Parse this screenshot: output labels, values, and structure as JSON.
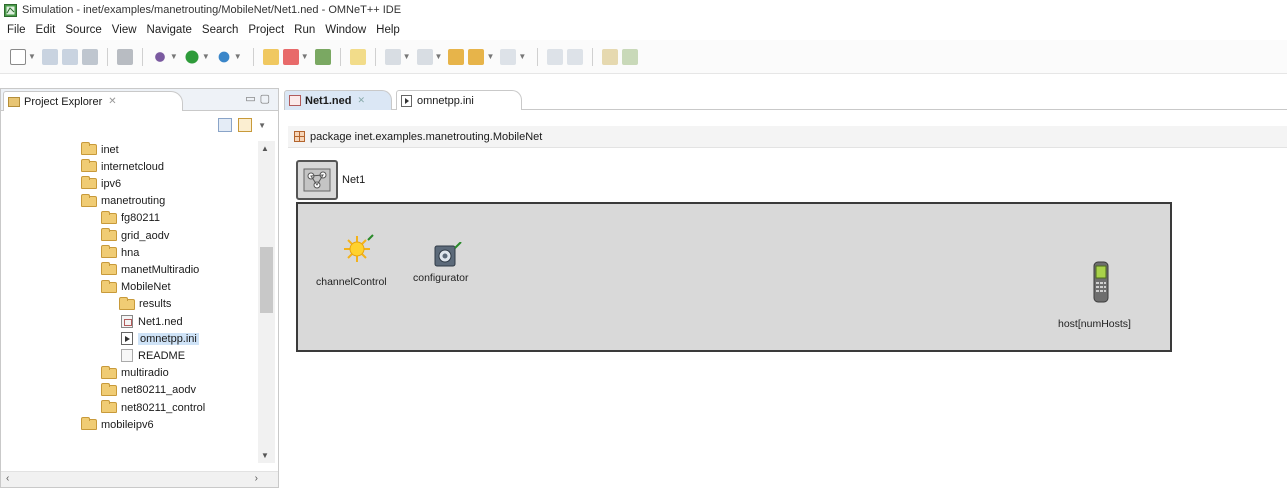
{
  "window": {
    "title": "Simulation - inet/examples/manetrouting/MobileNet/Net1.ned - OMNeT++ IDE",
    "icon": "omnetpp-ide-icon"
  },
  "menu": [
    "File",
    "Edit",
    "Source",
    "View",
    "Navigate",
    "Search",
    "Project",
    "Run",
    "Window",
    "Help"
  ],
  "explorer": {
    "tab_label": "Project Explorer",
    "tab_close": "✕",
    "tree": [
      {
        "label": "inet",
        "type": "folder",
        "depth": 1
      },
      {
        "label": "internetcloud",
        "type": "folder",
        "depth": 1
      },
      {
        "label": "ipv6",
        "type": "folder",
        "depth": 1
      },
      {
        "label": "manetrouting",
        "type": "folder",
        "depth": 1
      },
      {
        "label": "fg80211",
        "type": "folder",
        "depth": 2
      },
      {
        "label": "grid_aodv",
        "type": "folder",
        "depth": 2
      },
      {
        "label": "hna",
        "type": "folder",
        "depth": 2
      },
      {
        "label": "manetMultiradio",
        "type": "folder",
        "depth": 2
      },
      {
        "label": "MobileNet",
        "type": "folder",
        "depth": 2
      },
      {
        "label": "results",
        "type": "folder",
        "depth": 3
      },
      {
        "label": "Net1.ned",
        "type": "ned",
        "depth": 3
      },
      {
        "label": "omnetpp.ini",
        "type": "ini",
        "depth": 3,
        "selected": true
      },
      {
        "label": "README",
        "type": "txt",
        "depth": 3
      },
      {
        "label": "multiradio",
        "type": "folder",
        "depth": 2
      },
      {
        "label": "net80211_aodv",
        "type": "folder",
        "depth": 2
      },
      {
        "label": "net80211_control",
        "type": "folder",
        "depth": 2
      },
      {
        "label": "mobileipv6",
        "type": "folder",
        "depth": 1
      }
    ]
  },
  "editor": {
    "tabs": [
      {
        "label": "Net1.ned",
        "active": true
      },
      {
        "label": "omnetpp.ini",
        "active": false
      }
    ],
    "package_line": "package inet.examples.manetrouting.MobileNet",
    "network_name": "Net1",
    "submodules": [
      {
        "name": "channelControl",
        "icon": "channel-control-sun-icon"
      },
      {
        "name": "configurator",
        "icon": "configurator-gear-icon"
      },
      {
        "name": "host[numHosts]",
        "icon": "mobile-phone-icon"
      }
    ]
  },
  "colors": {
    "canvas_bg": "#d9d9d9",
    "canvas_border": "#3a3a3a",
    "selection": "#cfe3f7",
    "active_tab": "#dbe7f5",
    "folder": "#f0cc74"
  }
}
